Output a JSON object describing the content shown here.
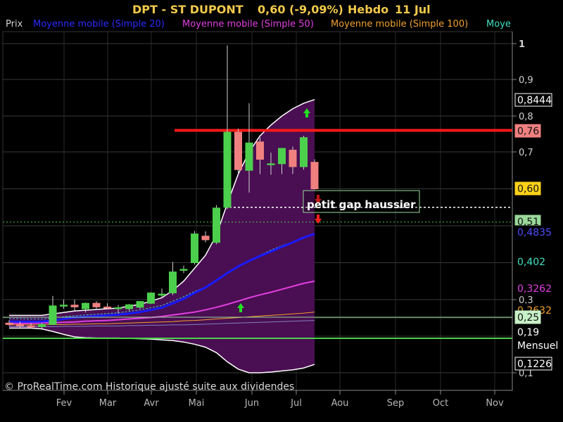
{
  "header": {
    "symbol": "DPT - ST DUPONT",
    "quote": "0,60 (-9,09%)",
    "period": "Hebdo",
    "date": "11 Jul"
  },
  "legend": [
    {
      "label": "Prix",
      "color": "#d0d0d0"
    },
    {
      "label": "Moyenne mobile (Simple 20)",
      "color": "#2b2bff"
    },
    {
      "label": "Moyenne mobile (Simple 50)",
      "color": "#e040e0"
    },
    {
      "label": "Moyenne mobile (Simple 100)",
      "color": "#f0a030"
    },
    {
      "label": "Moye",
      "color": "#40e0c0"
    }
  ],
  "copyright": "© ProRealTime.com Historique ajusté suite aux dividendes",
  "annotation": "petit gap haussier",
  "colors": {
    "up": "#4ccf4c",
    "down": "#f08080",
    "band_fill": "#4a0e52",
    "resistance": "#ff1a1a",
    "ma20": "#1a1aff",
    "ma50": "#e040e0",
    "ma100": "#f0a030",
    "ma200": "#40c0e0"
  },
  "chart_data": {
    "type": "candlestick",
    "y_ticks": [
      "1",
      "0,9",
      "0,8",
      "0,7",
      "0,3",
      "0,1"
    ],
    "y_range": [
      0.1,
      1.02
    ],
    "x_ticks": [
      "Fev",
      "Mar",
      "Avr",
      "Mai",
      "Jun",
      "Jul",
      "Aou",
      "Sep",
      "Oct",
      "Nov"
    ],
    "candles": [
      {
        "o": 0.236,
        "h": 0.244,
        "l": 0.228,
        "c": 0.232
      },
      {
        "o": 0.232,
        "h": 0.24,
        "l": 0.224,
        "c": 0.228
      },
      {
        "o": 0.228,
        "h": 0.236,
        "l": 0.222,
        "c": 0.226
      },
      {
        "o": 0.226,
        "h": 0.236,
        "l": 0.22,
        "c": 0.232
      },
      {
        "o": 0.232,
        "h": 0.31,
        "l": 0.23,
        "c": 0.283
      },
      {
        "o": 0.285,
        "h": 0.3,
        "l": 0.275,
        "c": 0.285
      },
      {
        "o": 0.285,
        "h": 0.3,
        "l": 0.27,
        "c": 0.28
      },
      {
        "o": 0.275,
        "h": 0.292,
        "l": 0.265,
        "c": 0.29
      },
      {
        "o": 0.29,
        "h": 0.296,
        "l": 0.275,
        "c": 0.28
      },
      {
        "o": 0.28,
        "h": 0.29,
        "l": 0.275,
        "c": 0.277
      },
      {
        "o": 0.277,
        "h": 0.285,
        "l": 0.262,
        "c": 0.278
      },
      {
        "o": 0.275,
        "h": 0.288,
        "l": 0.27,
        "c": 0.286
      },
      {
        "o": 0.279,
        "h": 0.296,
        "l": 0.275,
        "c": 0.295
      },
      {
        "o": 0.29,
        "h": 0.32,
        "l": 0.288,
        "c": 0.318
      },
      {
        "o": 0.312,
        "h": 0.33,
        "l": 0.305,
        "c": 0.315
      },
      {
        "o": 0.318,
        "h": 0.402,
        "l": 0.312,
        "c": 0.375
      },
      {
        "o": 0.38,
        "h": 0.392,
        "l": 0.372,
        "c": 0.382
      },
      {
        "o": 0.4,
        "h": 0.486,
        "l": 0.395,
        "c": 0.478
      },
      {
        "o": 0.472,
        "h": 0.485,
        "l": 0.455,
        "c": 0.462
      },
      {
        "o": 0.455,
        "h": 0.556,
        "l": 0.45,
        "c": 0.548
      },
      {
        "o": 0.55,
        "h": 0.995,
        "l": 0.545,
        "c": 0.755
      },
      {
        "o": 0.755,
        "h": 0.765,
        "l": 0.64,
        "c": 0.652
      },
      {
        "o": 0.65,
        "h": 0.835,
        "l": 0.59,
        "c": 0.725
      },
      {
        "o": 0.728,
        "h": 0.74,
        "l": 0.64,
        "c": 0.68
      },
      {
        "o": 0.668,
        "h": 0.698,
        "l": 0.638,
        "c": 0.668
      },
      {
        "o": 0.668,
        "h": 0.71,
        "l": 0.64,
        "c": 0.71
      },
      {
        "o": 0.705,
        "h": 0.715,
        "l": 0.64,
        "c": 0.66
      },
      {
        "o": 0.66,
        "h": 0.745,
        "l": 0.652,
        "c": 0.74
      },
      {
        "o": 0.672,
        "h": 0.68,
        "l": 0.598,
        "c": 0.6
      }
    ],
    "ma20": [
      0.24,
      0.24,
      0.24,
      0.24,
      0.243,
      0.247,
      0.251,
      0.253,
      0.255,
      0.257,
      0.259,
      0.262,
      0.266,
      0.272,
      0.278,
      0.29,
      0.302,
      0.318,
      0.333,
      0.352,
      0.372,
      0.39,
      0.405,
      0.418,
      0.43,
      0.443,
      0.455,
      0.468,
      0.478
    ],
    "ma50": [
      0.235,
      0.235,
      0.235,
      0.236,
      0.237,
      0.238,
      0.239,
      0.241,
      0.242,
      0.243,
      0.245,
      0.247,
      0.249,
      0.251,
      0.254,
      0.258,
      0.262,
      0.266,
      0.272,
      0.279,
      0.287,
      0.296,
      0.305,
      0.313,
      0.32,
      0.328,
      0.336,
      0.344,
      0.35
    ],
    "ma100": [
      0.231,
      0.231,
      0.231,
      0.231,
      0.232,
      0.232,
      0.233,
      0.233,
      0.234,
      0.234,
      0.235,
      0.236,
      0.237,
      0.238,
      0.239,
      0.24,
      0.242,
      0.243,
      0.245,
      0.247,
      0.249,
      0.251,
      0.253,
      0.255,
      0.257,
      0.259,
      0.261,
      0.263,
      0.266
    ],
    "ma200": [
      0.226,
      0.226,
      0.226,
      0.226,
      0.226,
      0.227,
      0.227,
      0.227,
      0.228,
      0.228,
      0.228,
      0.229,
      0.229,
      0.23,
      0.23,
      0.231,
      0.231,
      0.232,
      0.233,
      0.234,
      0.235,
      0.236,
      0.237,
      0.238,
      0.239,
      0.24,
      0.241,
      0.242,
      0.243
    ],
    "ma20_band_mid": [
      0.248,
      0.248,
      0.247,
      0.247,
      0.25,
      0.253,
      0.256,
      0.258,
      0.26,
      0.262,
      0.264,
      0.268,
      0.272,
      0.278,
      0.284,
      0.296,
      0.308,
      0.322,
      0.334,
      0.35,
      0.37,
      0.388,
      0.404,
      0.42,
      0.434,
      0.446,
      0.456,
      0.466,
      0.478
    ],
    "bollinger_upper": [
      0.257,
      0.257,
      0.257,
      0.257,
      0.261,
      0.265,
      0.269,
      0.271,
      0.273,
      0.275,
      0.277,
      0.282,
      0.287,
      0.296,
      0.305,
      0.325,
      0.35,
      0.385,
      0.42,
      0.475,
      0.56,
      0.64,
      0.7,
      0.745,
      0.775,
      0.8,
      0.82,
      0.835,
      0.845
    ],
    "bollinger_lower": [
      0.222,
      0.222,
      0.222,
      0.22,
      0.213,
      0.205,
      0.198,
      0.196,
      0.195,
      0.195,
      0.195,
      0.194,
      0.193,
      0.192,
      0.19,
      0.188,
      0.184,
      0.178,
      0.17,
      0.155,
      0.13,
      0.11,
      0.1,
      0.1,
      0.102,
      0.105,
      0.108,
      0.113,
      0.123
    ],
    "resistance_level": 0.76,
    "gap_level": 0.55,
    "support_level": 0.51,
    "right_labels": [
      {
        "text": "0,8444",
        "value": 0.8444,
        "bg": "#000000",
        "fg": "#ffffff",
        "border": "#ffffff"
      },
      {
        "text": "0,76",
        "value": 0.76,
        "bg": "#f08080",
        "fg": "#111111",
        "border": "#f08080"
      },
      {
        "text": "0,60",
        "value": 0.6,
        "bg": "#ffd21a",
        "fg": "#111111",
        "border": "#ffd21a"
      },
      {
        "text": "0,51",
        "value": 0.51,
        "bg": "#9ad89a",
        "fg": "#111111",
        "border": "#9ad89a"
      },
      {
        "text": "0,4835",
        "value": 0.4835,
        "bg": "#000000",
        "fg": "#4d4dff",
        "border": "#000000"
      },
      {
        "text": "0,402",
        "value": 0.402,
        "bg": "#000000",
        "fg": "#40e0c0",
        "border": "#000000"
      },
      {
        "text": "0,3262",
        "value": 0.3262,
        "bg": "#000000",
        "fg": "#e040e0",
        "border": "#000000"
      },
      {
        "text": "0,2632",
        "value": 0.2632,
        "bg": "#000000",
        "fg": "#f0a030",
        "border": "#000000"
      },
      {
        "text": "0,25",
        "value": 0.25,
        "bg": "#c8f0c8",
        "fg": "#111111",
        "border": "#c8f0c8"
      },
      {
        "text": "0,19",
        "value": 0.19,
        "bg": "#000000",
        "fg": "#ffffff",
        "border": "#000000"
      },
      {
        "text": "Mensuel",
        "value": 0.19,
        "bg": "#000000",
        "fg": "#ffffff",
        "border": "#000000"
      },
      {
        "text": "0,1226",
        "value": 0.1226,
        "bg": "#000000",
        "fg": "#ffffff",
        "border": "#ffffff"
      }
    ]
  }
}
